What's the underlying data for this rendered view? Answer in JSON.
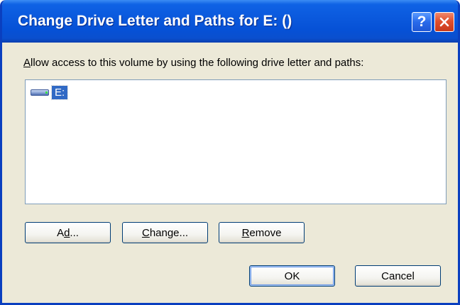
{
  "window": {
    "title": "Change Drive Letter and Paths for E: ()",
    "help_glyph": "?",
    "close_glyph": "✕"
  },
  "content": {
    "instruction_access_key": "A",
    "instruction_rest": "llow access to this volume by using the following drive letter and paths:",
    "list_items": [
      {
        "label": "E:",
        "icon": "drive-icon",
        "selected": true
      }
    ]
  },
  "buttons": {
    "add": {
      "access_key": "d",
      "pre": "A",
      "post": "d...",
      "label": "Add..."
    },
    "change": {
      "access_key": "C",
      "pre": "",
      "post": "hange...",
      "label": "Change..."
    },
    "remove": {
      "access_key": "R",
      "pre": "",
      "post": "emove",
      "label": "Remove"
    },
    "ok": "OK",
    "cancel": "Cancel"
  },
  "colors": {
    "titlebar": "#0A58DC",
    "face": "#ECE9D8",
    "selection": "#316AC5",
    "close": "#E0502E"
  }
}
